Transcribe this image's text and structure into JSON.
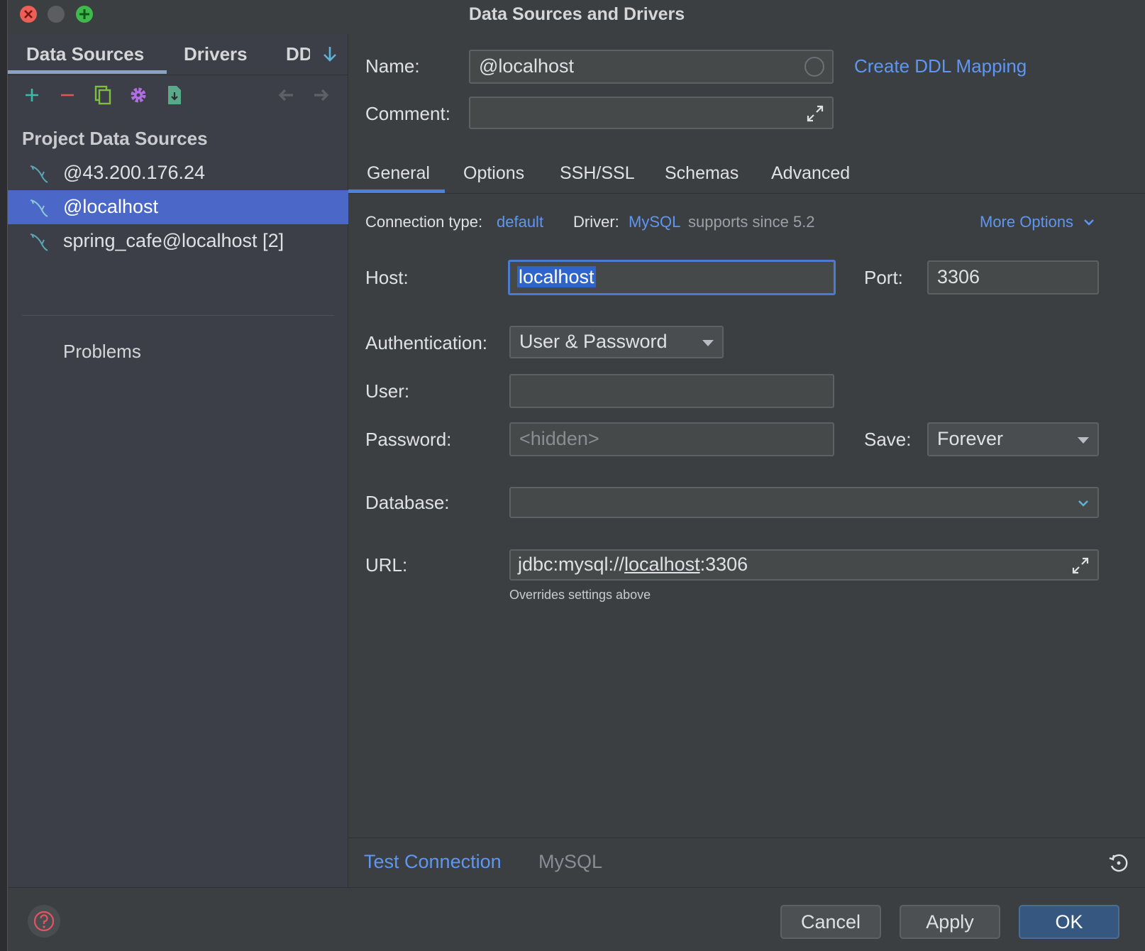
{
  "window": {
    "title": "Data Sources and Drivers"
  },
  "left": {
    "tabs": [
      "Data Sources",
      "Drivers",
      "DD"
    ],
    "section_title": "Project Data Sources",
    "items": [
      {
        "label": "@43.200.176.24",
        "selected": false
      },
      {
        "label": "@localhost",
        "selected": true
      },
      {
        "label": "spring_cafe@localhost [2]",
        "selected": false
      }
    ],
    "problems_label": "Problems"
  },
  "form": {
    "name_label": "Name:",
    "name_value": "@localhost",
    "create_ddl_link": "Create DDL Mapping",
    "comment_label": "Comment:",
    "comment_value": "",
    "tabs": [
      "General",
      "Options",
      "SSH/SSL",
      "Schemas",
      "Advanced"
    ],
    "active_tab": "General",
    "connection_type_label": "Connection type:",
    "connection_type_value": "default",
    "driver_label": "Driver:",
    "driver_value": "MySQL",
    "driver_note": "supports since 5.2",
    "more_options": "More Options",
    "host_label": "Host:",
    "host_value": "localhost",
    "port_label": "Port:",
    "port_value": "3306",
    "auth_label": "Authentication:",
    "auth_value": "User & Password",
    "user_label": "User:",
    "user_value": "",
    "password_label": "Password:",
    "password_placeholder": "<hidden>",
    "save_label": "Save:",
    "save_value": "Forever",
    "database_label": "Database:",
    "database_value": "",
    "url_label": "URL:",
    "url_prefix": "jdbc:mysql://",
    "url_host": "localhost",
    "url_suffix": ":3306",
    "url_hint": "Overrides settings above",
    "test_connection": "Test Connection",
    "driver_footer": "MySQL"
  },
  "footer": {
    "cancel": "Cancel",
    "apply": "Apply",
    "ok": "OK"
  },
  "colors": {
    "accent": "#5e96f2",
    "selection": "#4b67c7",
    "ok_button": "#365880"
  }
}
